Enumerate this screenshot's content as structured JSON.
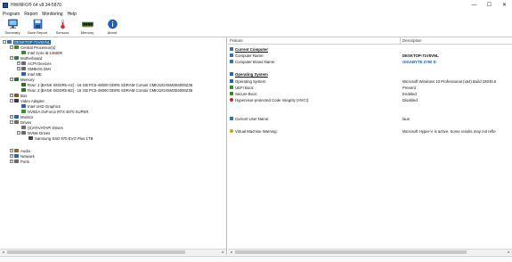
{
  "window": {
    "title": "HWiNFO® 64 v8.34-5870",
    "minimize": "—",
    "maximize": "☐",
    "close": "✕"
  },
  "menu": [
    "Program",
    "Report",
    "Monitoring",
    "Help"
  ],
  "toolbar": [
    {
      "label": "Summary",
      "icon": "summary-icon"
    },
    {
      "label": "Save Report",
      "icon": "save-report-icon"
    },
    {
      "label": "Sensors",
      "icon": "sensors-icon"
    },
    {
      "label": "Memory",
      "icon": "memory-icon"
    },
    {
      "label": "About",
      "icon": "about-icon"
    }
  ],
  "tree": [
    {
      "text": "DESKTOP-71V5VNL",
      "expander": "−",
      "icon": "computer-icon",
      "color": "#3a6fb5",
      "selected": true
    },
    {
      "text": "Central Processor(s)",
      "expander": "−",
      "icon": "cpu-icon",
      "color": "#4b7f3a"
    },
    {
      "text": "Intel Core i5-14600K",
      "expander": "",
      "icon": "cpu-chip-icon",
      "color": "#4b7f3a"
    },
    {
      "text": "Motherboard",
      "expander": "−",
      "icon": "motherboard-icon",
      "color": "#2f7a47"
    },
    {
      "text": "ACPI Devices",
      "expander": "+",
      "icon": "acpi-icon",
      "color": "#6a6a6a"
    },
    {
      "text": "SMBIOS DMI",
      "expander": "+",
      "icon": "smbios-icon",
      "color": "#6a6a6a"
    },
    {
      "text": "Intel ME",
      "expander": "",
      "icon": "intel-me-icon",
      "color": "#2d62a8"
    },
    {
      "text": "Memory",
      "expander": "−",
      "icon": "memory-tree-icon",
      "color": "#2f6b2f"
    },
    {
      "text": "Row: 1 [BANK 0/DDR5-A2] - 16 GB PC5-48000 DDR5 SDRAM Corsair CMK32GX5M2E6000Z36",
      "expander": "",
      "icon": "ram-stick-icon",
      "color": "#2f6b2f"
    },
    {
      "text": "Row: 3 [BANK 0/DDR5-B2] - 16 GB PC5-48000 DDR5 SDRAM Corsair CMK32GX5M2E6000Z36",
      "expander": "",
      "icon": "ram-stick-icon",
      "color": "#2f6b2f"
    },
    {
      "text": "Bus",
      "expander": "+",
      "icon": "bus-icon",
      "color": "#7a5a2f"
    },
    {
      "text": "Video Adapter",
      "expander": "−",
      "icon": "video-adapter-icon",
      "color": "#3a3a3a"
    },
    {
      "text": "Intel UHD Graphics",
      "expander": "",
      "icon": "gpu-icon",
      "color": "#2d62a8"
    },
    {
      "text": "NVIDIA GeForce RTX 4070 SUPER",
      "expander": "",
      "icon": "gpu-icon",
      "color": "#3f8f2f"
    },
    {
      "text": "Monitor",
      "expander": "+",
      "icon": "monitor-icon",
      "color": "#2d62a8"
    },
    {
      "text": "Drives",
      "expander": "−",
      "icon": "drives-icon",
      "color": "#6a6a6a"
    },
    {
      "text": "(S)ATA/ATAPI Drives",
      "expander": "",
      "icon": "sata-drive-icon",
      "color": "#6a6a6a"
    },
    {
      "text": "NVMe Drives",
      "expander": "−",
      "icon": "nvme-drive-icon",
      "color": "#6a6a6a"
    },
    {
      "text": "Samsung SSD 970 EVO Plus 1TB",
      "expander": "",
      "icon": "ssd-icon",
      "color": "#4a4a4a"
    },
    {
      "text": "Audio",
      "expander": "+",
      "icon": "audio-icon",
      "color": "#8a6a2f"
    },
    {
      "text": "Network",
      "expander": "+",
      "icon": "network-icon",
      "color": "#2d62a8"
    },
    {
      "text": "Ports",
      "expander": "+",
      "icon": "ports-icon",
      "color": "#6a6a6a"
    }
  ],
  "details": {
    "header": {
      "feature": "Feature",
      "description": "Description"
    },
    "rows": [
      {
        "feature": "Current Computer",
        "value": "",
        "section": true,
        "icon": "computer-section-icon",
        "color": "#3a6fb5"
      },
      {
        "feature": "Computer Name:",
        "value": "DESKTOP-71V5VNL",
        "icon": "computer-name-icon",
        "color": "#3a6fb5",
        "vstyle": "strong"
      },
      {
        "feature": "Computer Brand Name:",
        "value": "GIGABYTE Z790 D",
        "icon": "brand-icon",
        "color": "#3a6fb5",
        "vstyle": "brand"
      },
      {
        "feature": "",
        "value": "",
        "spacer": true
      },
      {
        "feature": "Operating System",
        "value": "",
        "section": true,
        "icon": "os-section-icon",
        "color": "#2d62a8"
      },
      {
        "feature": "Operating System:",
        "value": "Microsoft Windows 10 Professional (x64) Build 19045.6",
        "icon": "os-icon",
        "color": "#2d62a8"
      },
      {
        "feature": "UEFI Boot:",
        "value": "Present",
        "icon": "uefi-icon",
        "color": "#2f8f2f"
      },
      {
        "feature": "Secure Boot:",
        "value": "Enabled",
        "icon": "secure-boot-icon",
        "color": "#2f8f2f"
      },
      {
        "feature": "Hypervisor-protected Code Integrity (HVCI):",
        "value": "Disabled",
        "icon": "hvci-warning-icon",
        "color": "#c62828"
      },
      {
        "feature": "",
        "value": "",
        "spacer": true
      },
      {
        "feature": "Current User Name:",
        "value": "laun",
        "icon": "user-icon",
        "color": "#3a6fb5"
      },
      {
        "feature": "",
        "value": "",
        "spacer": true
      },
      {
        "feature": "Virtual Machine Warning:",
        "value": "Microsoft Hyper-V is active. Some results may not refle",
        "icon": "vm-warning-icon",
        "color": "#d4a017"
      }
    ]
  }
}
